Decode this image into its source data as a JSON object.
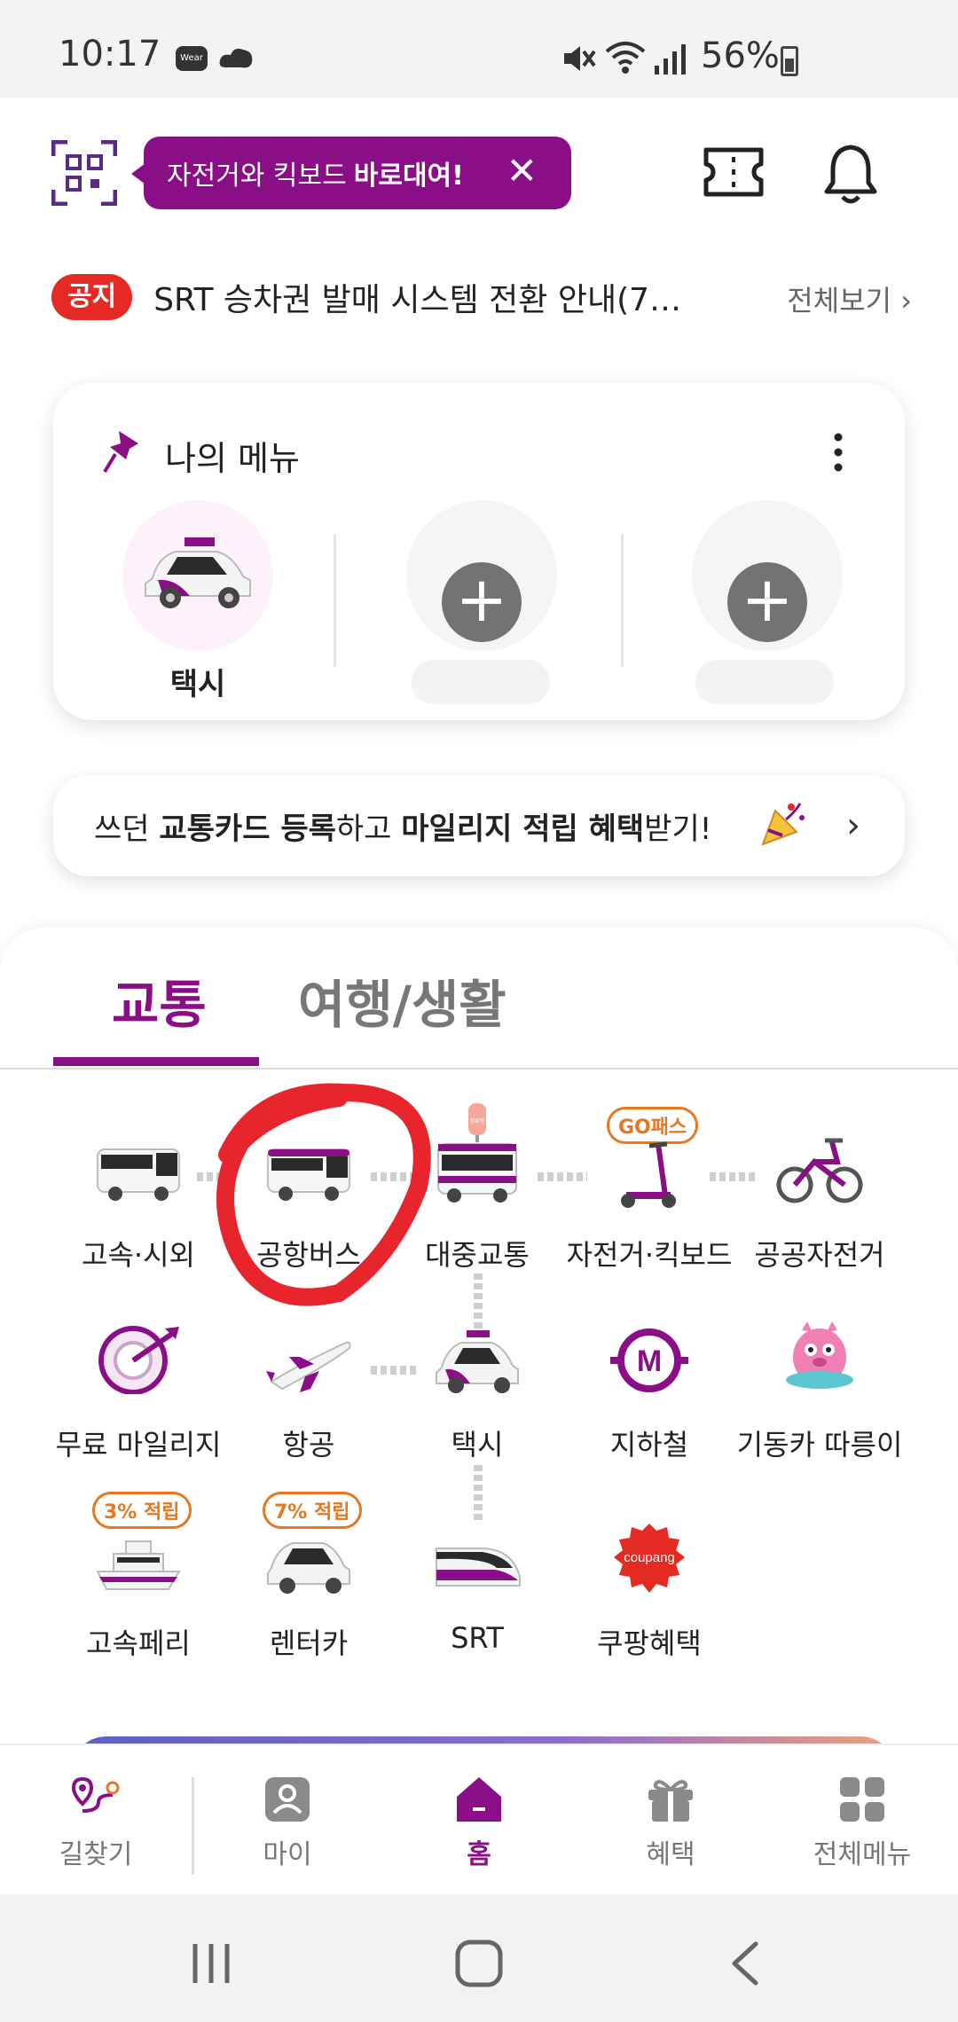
{
  "status_bar": {
    "time": "10:17",
    "wear_label": "Wear",
    "battery": "56%"
  },
  "header": {
    "promo_text": "자전거와 킥보드",
    "promo_bold": "바로대여!",
    "promo_close": "✕"
  },
  "notice": {
    "badge": "공지",
    "text": "SRT 승차권 발매 시스템 전환 안내(7…",
    "more": "전체보기 ›"
  },
  "my_menu": {
    "title": "나의 메뉴",
    "slots": [
      {
        "label": "택시",
        "icon": "taxi-icon"
      },
      {
        "label": "",
        "icon": "plus-icon"
      },
      {
        "label": "",
        "icon": "plus-icon"
      }
    ]
  },
  "card_banner": {
    "parts": [
      "쓰던 ",
      "교통카드 등록",
      "하고 ",
      "마일리지 적립 혜택",
      "받기!"
    ],
    "arrow": "›"
  },
  "tabs": [
    {
      "label": "교통",
      "active": true
    },
    {
      "label": "여행/생활",
      "active": false
    }
  ],
  "transport": {
    "express_bus": "고속·시외",
    "airport_bus": "공항버스",
    "public_transit": "대중교통",
    "bike_kickboard": "자전거·킥보드",
    "public_bike": "공공자전거",
    "go_pass_badge": "GO패스",
    "free_mileage": "무료 마일리지",
    "airline": "항공",
    "taxi": "택시",
    "subway": "지하철",
    "subway_icon_letter": "M",
    "mascot": "기동카 따릉이",
    "ferry": "고속페리",
    "ferry_badge": "3% 적립",
    "rental_car": "렌터카",
    "rental_badge": "7% 적립",
    "srt": "SRT",
    "coupang": "쿠팡혜택",
    "coupang_logo": "coupang",
    "bus_stop_sign": "정류장"
  },
  "bottom_nav": [
    {
      "label": "길찾기",
      "icon": "route-icon",
      "active": false
    },
    {
      "label": "마이",
      "icon": "person-icon",
      "active": false
    },
    {
      "label": "홈",
      "icon": "home-icon",
      "active": true
    },
    {
      "label": "혜택",
      "icon": "gift-icon",
      "active": false
    },
    {
      "label": "전체메뉴",
      "icon": "grid-icon",
      "active": false
    }
  ],
  "colors": {
    "brand_purple": "#8a0f86",
    "notice_red": "#e52a24",
    "badge_orange": "#e87722",
    "annotation_red": "#e8242c"
  }
}
